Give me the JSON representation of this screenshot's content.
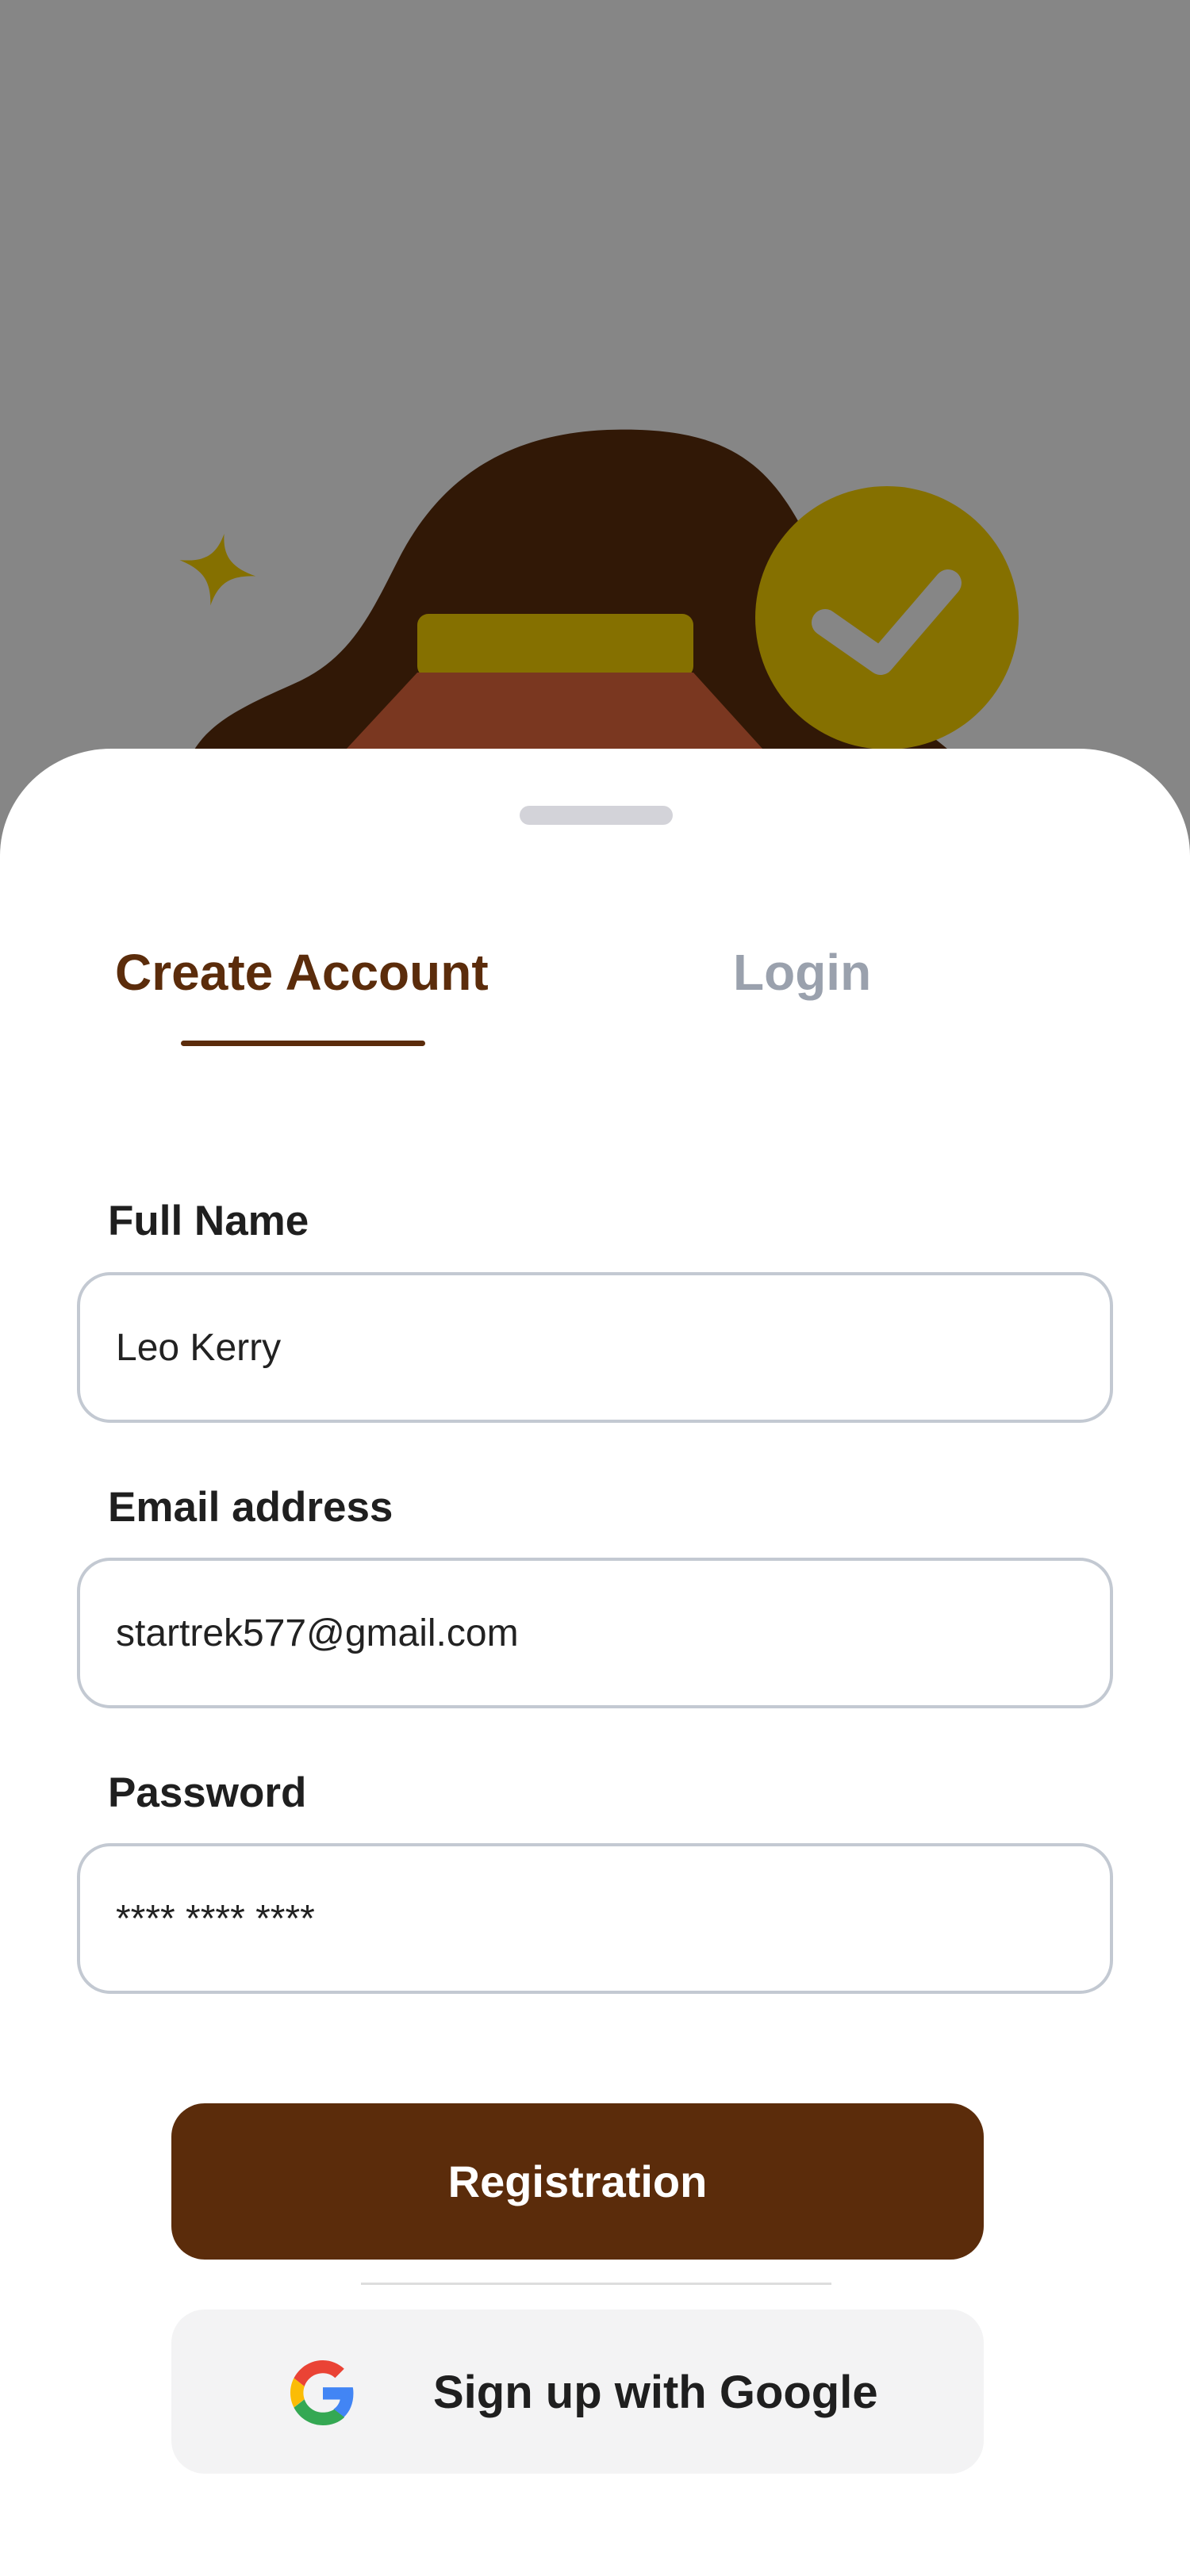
{
  "tabs": {
    "create_account": "Create Account",
    "login": "Login"
  },
  "form": {
    "full_name": {
      "label": "Full Name",
      "value": "Leo Kerry"
    },
    "email": {
      "label": "Email address",
      "value": "startrek577@gmail.com"
    },
    "password": {
      "label": "Password",
      "value": "**** **** ****"
    }
  },
  "actions": {
    "register_label": "Registration",
    "google_label": "Sign up with Google"
  },
  "icons": {
    "google": "google-logo-icon",
    "sparkle": "sparkle-icon",
    "check": "check-circle-icon"
  },
  "colors": {
    "overlay": "#868686",
    "brand_brown": "#5b2c0b",
    "hair_dark": "#311806",
    "mustard": "#857000",
    "rust": "#7a3720",
    "inactive_tab": "#9aa1ad",
    "input_border": "#c3c9d2",
    "google_button_bg": "#f3f3f4"
  }
}
